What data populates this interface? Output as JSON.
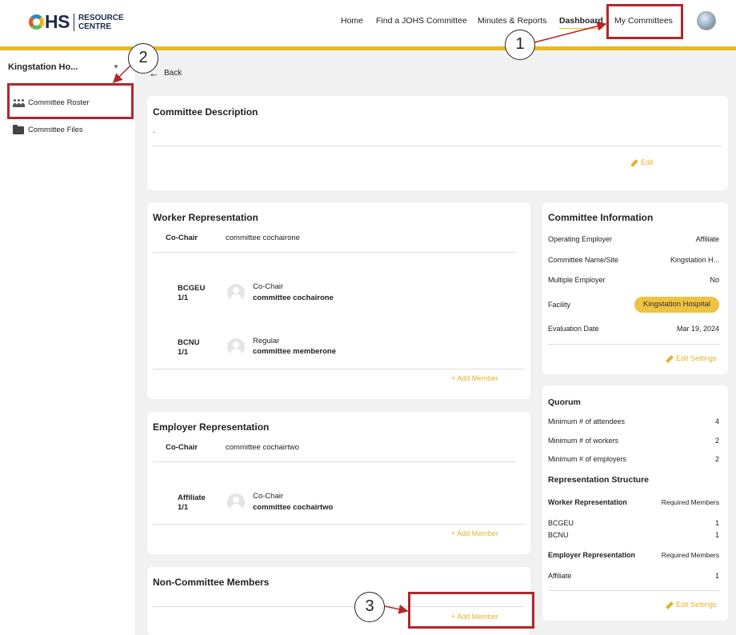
{
  "header": {
    "logo_main": "HS",
    "logo_sub_1": "RESOURCE",
    "logo_sub_2": "CENTRE",
    "nav": {
      "home": "Home",
      "find": "Find a JOHS Committee",
      "minutes": "Minutes & Reports",
      "dashboard": "Dashboard",
      "my_committees": "My Committees"
    }
  },
  "sidebar": {
    "title": "Kingstation Ho...",
    "items": [
      {
        "label": "Committee Roster",
        "icon": "people-icon"
      },
      {
        "label": "Committee Files",
        "icon": "folder-icon"
      }
    ]
  },
  "back_label": "Back",
  "description_card": {
    "title": "Committee Description",
    "text": ".",
    "edit": "Edit"
  },
  "worker_card": {
    "title": "Worker Representation",
    "cochair_label": "Co-Chair",
    "cochair_name": "committee cochairone",
    "members": [
      {
        "union": "BCGEU",
        "count": "1/1",
        "role": "Co-Chair",
        "name": "committee cochairone"
      },
      {
        "union": "BCNU",
        "count": "1/1",
        "role": "Regular",
        "name": "committee memberone"
      }
    ],
    "add": "+ Add Member"
  },
  "employer_card": {
    "title": "Employer Representation",
    "cochair_label": "Co-Chair",
    "cochair_name": "committee cochairtwo",
    "members": [
      {
        "union": "Affiliate",
        "count": "1/1",
        "role": "Co-Chair",
        "name": "committee cochairtwo"
      }
    ],
    "add": "+ Add Member"
  },
  "noncommittee_card": {
    "title": "Non-Committee Members",
    "add": "+ Add Member"
  },
  "info_card": {
    "title": "Committee Information",
    "rows": [
      {
        "label": "Operating Employer",
        "value": "Affiliate"
      },
      {
        "label": "Committee Name/Site",
        "value": "Kingstation H..."
      },
      {
        "label": "Multiple Employer",
        "value": "No"
      },
      {
        "label": "Facility",
        "value": "Kingstation Hospital"
      },
      {
        "label": "Evaluation Date",
        "value": "Mar 19, 2024"
      }
    ],
    "edit": "Edit Settings"
  },
  "quorum_card": {
    "title": "Quorum",
    "rows": [
      {
        "label": "Minimum # of attendees",
        "value": "4"
      },
      {
        "label": "Minimum # of workers",
        "value": "2"
      },
      {
        "label": "Minimum # of employers",
        "value": "2"
      }
    ],
    "structure_title": "Representation Structure",
    "worker_header": "Worker Representation",
    "required_label": "Required Members",
    "worker_rows": [
      {
        "label": "BCGEU",
        "value": "1"
      },
      {
        "label": "BCNU",
        "value": "1"
      }
    ],
    "employer_header": "Employer Representation",
    "employer_rows": [
      {
        "label": "Affiliate",
        "value": "1"
      }
    ],
    "edit": "Edit Settings"
  },
  "annotations": {
    "one": "1",
    "two": "2",
    "three": "3",
    "box_color": "#b3262a"
  },
  "colors": {
    "accent": "#e8b923",
    "link": "#e3b22a",
    "badge": "#f0c242"
  }
}
